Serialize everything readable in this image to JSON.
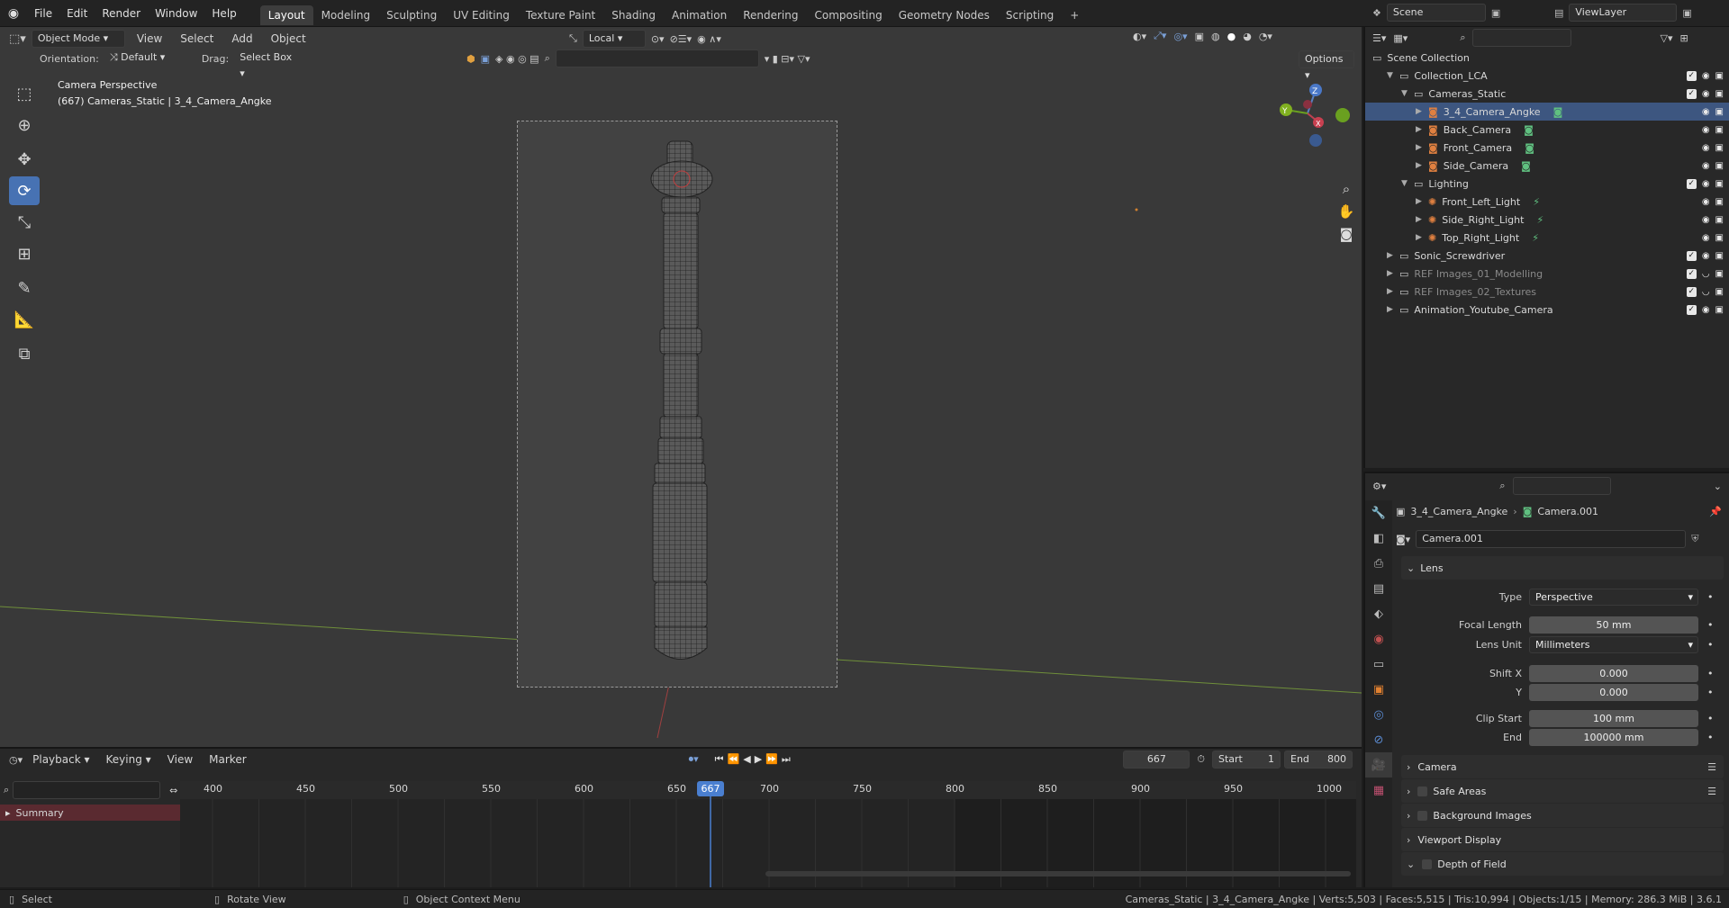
{
  "topbar": {
    "menus": [
      "File",
      "Edit",
      "Render",
      "Window",
      "Help"
    ],
    "workspaces": [
      "Layout",
      "Modeling",
      "Sculpting",
      "UV Editing",
      "Texture Paint",
      "Shading",
      "Animation",
      "Rendering",
      "Compositing",
      "Geometry Nodes",
      "Scripting"
    ],
    "active_workspace": "Layout",
    "add_tab": "+",
    "scene": "Scene",
    "view_layer": "ViewLayer"
  },
  "viewport_header": {
    "mode": "Object Mode",
    "menus": [
      "View",
      "Select",
      "Add",
      "Object"
    ],
    "transform_space": "Local",
    "orientation_label": "Orientation:",
    "orientation_value": "Default",
    "drag_label": "Drag:",
    "drag_value": "Select Box",
    "options": "Options"
  },
  "viewport_overlay": {
    "view_name": "Camera Perspective",
    "context": "(667) Cameras_Static | 3_4_Camera_Angke",
    "gizmo_axes": [
      "Z",
      "X",
      "Y"
    ]
  },
  "tools": [
    "select-box",
    "cursor",
    "move",
    "rotate",
    "scale",
    "transform",
    "annotate",
    "measure",
    "add-cube"
  ],
  "active_tool": "rotate",
  "outliner": {
    "root": "Scene Collection",
    "rows": [
      {
        "name": "Collection_LCA",
        "indent": 1,
        "type": "collection",
        "expanded": true,
        "selected": false,
        "dim": false
      },
      {
        "name": "Cameras_Static",
        "indent": 2,
        "type": "collection",
        "expanded": true,
        "selected": false,
        "dim": false
      },
      {
        "name": "3_4_Camera_Angke",
        "indent": 3,
        "type": "camera",
        "expanded": false,
        "selected": true,
        "dim": false
      },
      {
        "name": "Back_Camera",
        "indent": 3,
        "type": "camera",
        "expanded": false,
        "selected": false,
        "dim": false
      },
      {
        "name": "Front_Camera",
        "indent": 3,
        "type": "camera",
        "expanded": false,
        "selected": false,
        "dim": false
      },
      {
        "name": "Side_Camera",
        "indent": 3,
        "type": "camera",
        "expanded": false,
        "selected": false,
        "dim": false
      },
      {
        "name": "Lighting",
        "indent": 2,
        "type": "collection",
        "expanded": true,
        "selected": false,
        "dim": false
      },
      {
        "name": "Front_Left_Light",
        "indent": 3,
        "type": "light",
        "expanded": false,
        "selected": false,
        "dim": false
      },
      {
        "name": "Side_Right_Light",
        "indent": 3,
        "type": "light",
        "expanded": false,
        "selected": false,
        "dim": false
      },
      {
        "name": "Top_Right_Light",
        "indent": 3,
        "type": "light",
        "expanded": false,
        "selected": false,
        "dim": false
      },
      {
        "name": "Sonic_Screwdriver",
        "indent": 1,
        "type": "collection",
        "expanded": false,
        "selected": false,
        "dim": false
      },
      {
        "name": "REF Images_01_Modelling",
        "indent": 1,
        "type": "collection",
        "expanded": false,
        "selected": false,
        "dim": true
      },
      {
        "name": "REF Images_02_Textures",
        "indent": 1,
        "type": "collection",
        "expanded": false,
        "selected": false,
        "dim": true
      },
      {
        "name": "Animation_Youtube_Camera",
        "indent": 1,
        "type": "collection",
        "expanded": false,
        "selected": false,
        "dim": false
      }
    ]
  },
  "properties": {
    "breadcrumb_object": "3_4_Camera_Angke",
    "breadcrumb_data": "Camera.001",
    "datablock": "Camera.001",
    "lens_panel": "Lens",
    "type_label": "Type",
    "type_value": "Perspective",
    "focal_label": "Focal Length",
    "focal_value": "50 mm",
    "lens_unit_label": "Lens Unit",
    "lens_unit_value": "Millimeters",
    "shift_x_label": "Shift X",
    "shift_x_value": "0.000",
    "shift_y_label": "Y",
    "shift_y_value": "0.000",
    "clip_start_label": "Clip Start",
    "clip_start_value": "100 mm",
    "clip_end_label": "End",
    "clip_end_value": "100000 mm",
    "panels": [
      "Camera",
      "Safe Areas",
      "Background Images",
      "Viewport Display",
      "Depth of Field"
    ]
  },
  "timeline": {
    "menus": [
      "Playback",
      "Keying",
      "View",
      "Marker"
    ],
    "current_frame": "667",
    "start_label": "Start",
    "start_value": "1",
    "end_label": "End",
    "end_value": "800",
    "ruler": [
      "400",
      "450",
      "500",
      "550",
      "600",
      "650",
      "700",
      "750",
      "800",
      "850",
      "900",
      "950",
      "1000"
    ],
    "summary": "Summary"
  },
  "statusbar": {
    "select": "Select",
    "rotate": "Rotate View",
    "context_menu": "Object Context Menu",
    "info": "Cameras_Static | 3_4_Camera_Angke | Verts:5,503 | Faces:5,515 | Tris:10,994 | Objects:1/15 | Memory: 286.3 MiB | 3.6.1"
  }
}
